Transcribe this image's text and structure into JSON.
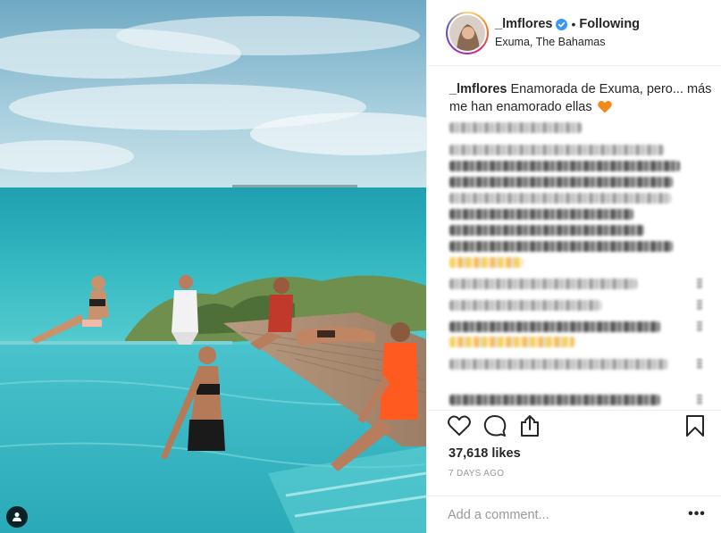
{
  "post": {
    "username": "_lmflores",
    "verified": true,
    "follow_status": "Following",
    "location": "Exuma, The Bahamas",
    "caption_user": "_lmflores",
    "caption_text": "Enamorada de Exuma, pero... más me han enamorado ellas",
    "caption_emoji": "orange-heart",
    "likes": "37,618 likes",
    "time_ago": "7 DAYS AGO"
  },
  "comment_box": {
    "placeholder": "Add a comment..."
  },
  "icons": {
    "like": "heart-outline-icon",
    "comment": "speech-bubble-icon",
    "share": "share-icon",
    "save": "bookmark-icon",
    "more": "more-icon",
    "user_tags": "user-tag-icon",
    "verified": "verified-badge-icon"
  },
  "colors": {
    "verified_blue": "#3897f0",
    "text_primary": "#262626",
    "text_secondary": "#999999",
    "divider": "#efefef",
    "sea": "#37b7bf",
    "sky": "#8ec2d4"
  }
}
